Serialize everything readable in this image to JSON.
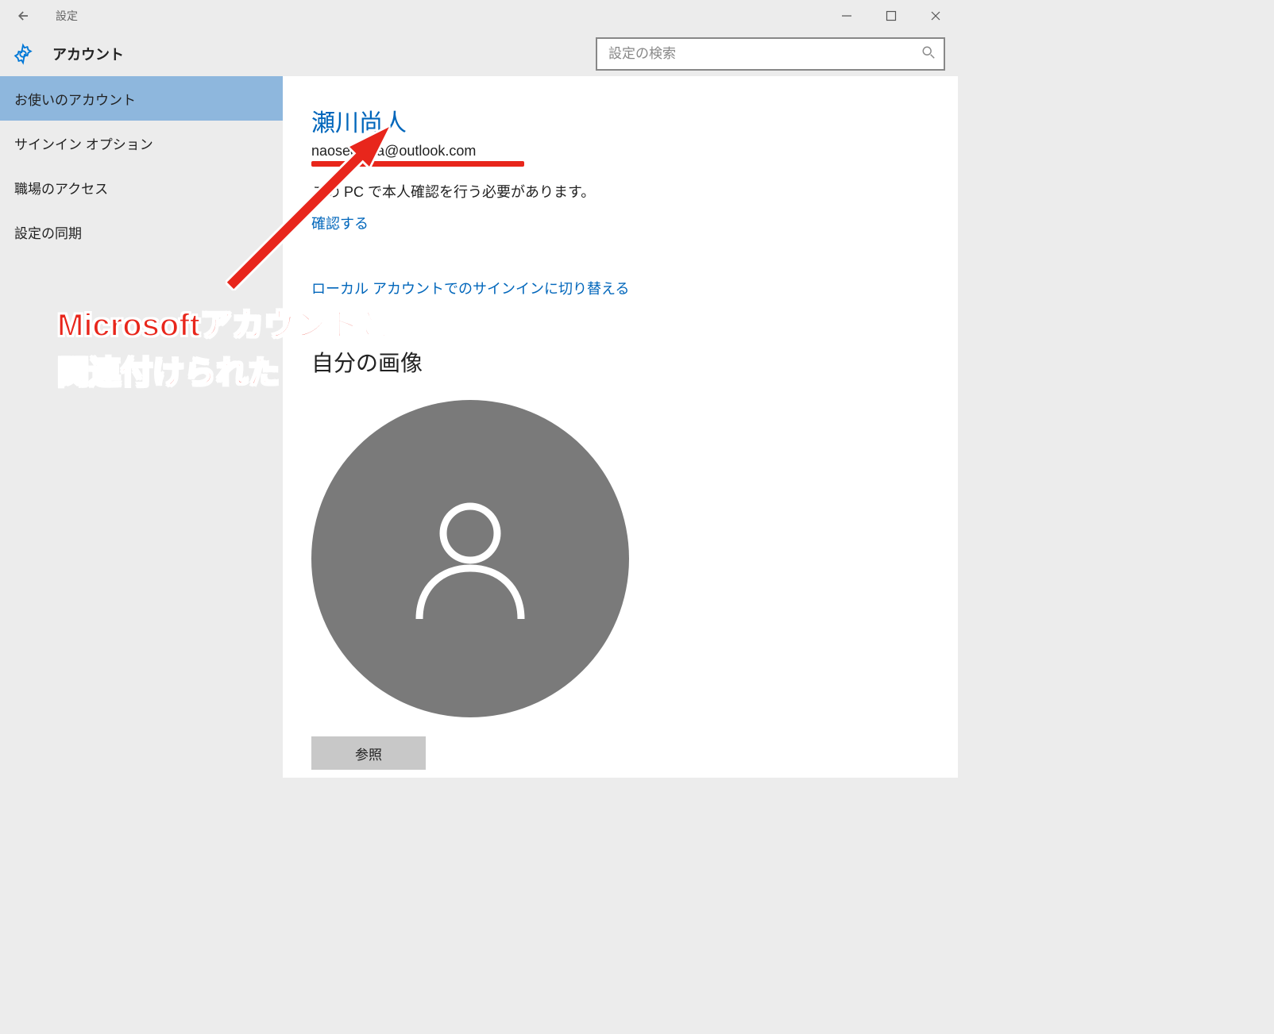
{
  "titlebar": {
    "label": "設定"
  },
  "header": {
    "title": "アカウント",
    "search_placeholder": "設定の検索"
  },
  "sidebar": {
    "items": [
      {
        "label": "お使いのアカウント",
        "selected": true
      },
      {
        "label": "サインイン オプション",
        "selected": false
      },
      {
        "label": "職場のアクセス",
        "selected": false
      },
      {
        "label": "設定の同期",
        "selected": false
      }
    ]
  },
  "account": {
    "display_name": "瀬川尚人",
    "email": "naosegawa@outlook.com",
    "verify_message": "この PC で本人確認を行う必要があります。",
    "verify_link": "確認する",
    "switch_local_link": "ローカル アカウントでのサインインに切り替える",
    "picture_heading": "自分の画像",
    "browse_button": "参照"
  },
  "annotation": {
    "line1": "Microsoftアカウントと",
    "line2": "関連付けられた"
  }
}
